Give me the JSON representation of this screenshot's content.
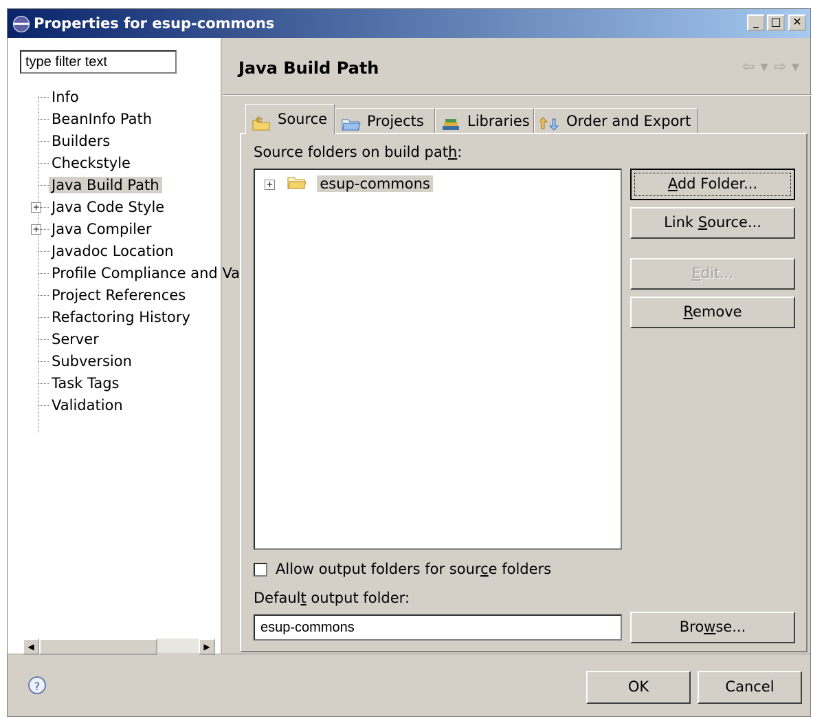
{
  "window": {
    "title": "Properties for esup-commons"
  },
  "filter": {
    "placeholder": "type filter text"
  },
  "tree": {
    "items": [
      {
        "label": "Info"
      },
      {
        "label": "BeanInfo Path"
      },
      {
        "label": "Builders"
      },
      {
        "label": "Checkstyle"
      },
      {
        "label": "Java Build Path",
        "selected": true
      },
      {
        "label": "Java Code Style",
        "expandable": true
      },
      {
        "label": "Java Compiler",
        "expandable": true
      },
      {
        "label": "Javadoc Location"
      },
      {
        "label": "Profile Compliance and Va"
      },
      {
        "label": "Project References"
      },
      {
        "label": "Refactoring History"
      },
      {
        "label": "Server"
      },
      {
        "label": "Subversion"
      },
      {
        "label": "Task Tags"
      },
      {
        "label": "Validation"
      }
    ]
  },
  "page": {
    "title": "Java Build Path"
  },
  "tabs": [
    {
      "label": "Source",
      "icon": "source-folder-icon",
      "active": true
    },
    {
      "label": "Projects",
      "icon": "project-folder-icon"
    },
    {
      "label": "Libraries",
      "icon": "libraries-icon"
    },
    {
      "label": "Order and Export",
      "icon": "order-export-icon"
    }
  ],
  "source": {
    "label": "Source folders on build path:",
    "folders": [
      {
        "name": "esup-commons",
        "icon": "folder-icon"
      }
    ]
  },
  "buttons": {
    "add_folder": "Add Folder...",
    "link_source": "Link Source...",
    "edit": "Edit...",
    "remove": "Remove",
    "browse": "Browse...",
    "ok": "OK",
    "cancel": "Cancel"
  },
  "options": {
    "allow_output_label": "Allow output folders for source folders",
    "allow_output_checked": false,
    "default_output_label": "Default output folder:",
    "default_output_value": "esup-commons"
  },
  "colors": {
    "titlebar": "#0a246a",
    "dialog": "#d4d0c8",
    "selection": "#d4d0c8"
  }
}
